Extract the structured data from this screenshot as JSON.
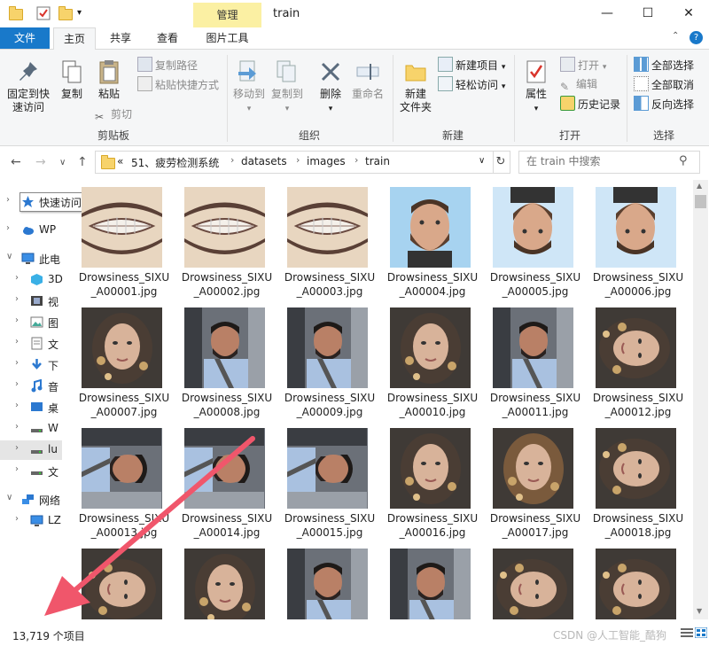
{
  "window": {
    "title": "train",
    "manage_tab": "管理"
  },
  "tabs": {
    "file": "文件",
    "home": "主页",
    "share": "共享",
    "view": "查看",
    "picture_tools": "图片工具"
  },
  "ribbon": {
    "clipboard": {
      "pin": "固定到快\n速访问",
      "copy": "复制",
      "paste": "粘贴",
      "copy_path": "复制路径",
      "paste_shortcut": "粘贴快捷方式",
      "cut": "剪切",
      "label": "剪贴板"
    },
    "organize": {
      "move_to": "移动到",
      "copy_to": "复制到",
      "delete": "删除",
      "rename": "重命名",
      "label": "组织"
    },
    "new": {
      "new_folder": "新建\n文件夹",
      "new_item": "新建项目",
      "easy_access": "轻松访问",
      "label": "新建"
    },
    "open": {
      "properties": "属性",
      "open": "打开",
      "edit": "编辑",
      "history": "历史记录",
      "label": "打开"
    },
    "select": {
      "select_all": "全部选择",
      "select_none": "全部取消",
      "invert": "反向选择",
      "label": "选择"
    }
  },
  "address": {
    "overflow": "«",
    "crumbs": [
      "51、疲劳检测系统",
      "datasets",
      "images",
      "train"
    ]
  },
  "search": {
    "placeholder": "在 train 中搜索"
  },
  "nav": {
    "items": [
      {
        "label": "快速访问"
      },
      {
        "label": "WP"
      },
      {
        "label": "此电"
      },
      {
        "label": "3D"
      },
      {
        "label": "视"
      },
      {
        "label": "图"
      },
      {
        "label": "文"
      },
      {
        "label": "下"
      },
      {
        "label": "音"
      },
      {
        "label": "桌"
      },
      {
        "label": "W"
      },
      {
        "label": "lu"
      },
      {
        "label": "文"
      },
      {
        "label": "网络"
      },
      {
        "label": "LZ"
      }
    ]
  },
  "files": [
    {
      "name": "Drowsiness_SIXU_A00001.jpg",
      "variant": "mouth"
    },
    {
      "name": "Drowsiness_SIXU_A00002.jpg",
      "variant": "mouth"
    },
    {
      "name": "Drowsiness_SIXU_A00003.jpg",
      "variant": "mouth"
    },
    {
      "name": "Drowsiness_SIXU_A00004.jpg",
      "variant": "man-sky"
    },
    {
      "name": "Drowsiness_SIXU_A00005.jpg",
      "variant": "man-sky-flip"
    },
    {
      "name": "Drowsiness_SIXU_A00006.jpg",
      "variant": "man-sky-flip"
    },
    {
      "name": "Drowsiness_SIXU_A00007.jpg",
      "variant": "woman"
    },
    {
      "name": "Drowsiness_SIXU_A00008.jpg",
      "variant": "car-man"
    },
    {
      "name": "Drowsiness_SIXU_A00009.jpg",
      "variant": "car-man"
    },
    {
      "name": "Drowsiness_SIXU_A00010.jpg",
      "variant": "woman"
    },
    {
      "name": "Drowsiness_SIXU_A00011.jpg",
      "variant": "car-man"
    },
    {
      "name": "Drowsiness_SIXU_A00012.jpg",
      "variant": "woman-rot"
    },
    {
      "name": "Drowsiness_SIXU_A00013.jpg",
      "variant": "car-man-rot"
    },
    {
      "name": "Drowsiness_SIXU_A00014.jpg",
      "variant": "car-man-rot"
    },
    {
      "name": "Drowsiness_SIXU_A00015.jpg",
      "variant": "car-man-rot"
    },
    {
      "name": "Drowsiness_SIXU_A00016.jpg",
      "variant": "woman"
    },
    {
      "name": "Drowsiness_SIXU_A00017.jpg",
      "variant": "woman-scarf"
    },
    {
      "name": "Drowsiness_SIXU_A00018.jpg",
      "variant": "woman-rot"
    },
    {
      "name": "",
      "variant": "woman-rot"
    },
    {
      "name": "",
      "variant": "woman"
    },
    {
      "name": "",
      "variant": "car-man"
    },
    {
      "name": "",
      "variant": "car-man"
    },
    {
      "name": "",
      "variant": "woman-rot"
    },
    {
      "name": "",
      "variant": "woman-rot"
    }
  ],
  "status": {
    "item_count": "13,719 个项目"
  },
  "watermark": "CSDN @人工智能_酷狗",
  "colors": {
    "accent": "#1979ca",
    "manage_tab": "#fbf0a3",
    "arrow": "#f0566b"
  }
}
